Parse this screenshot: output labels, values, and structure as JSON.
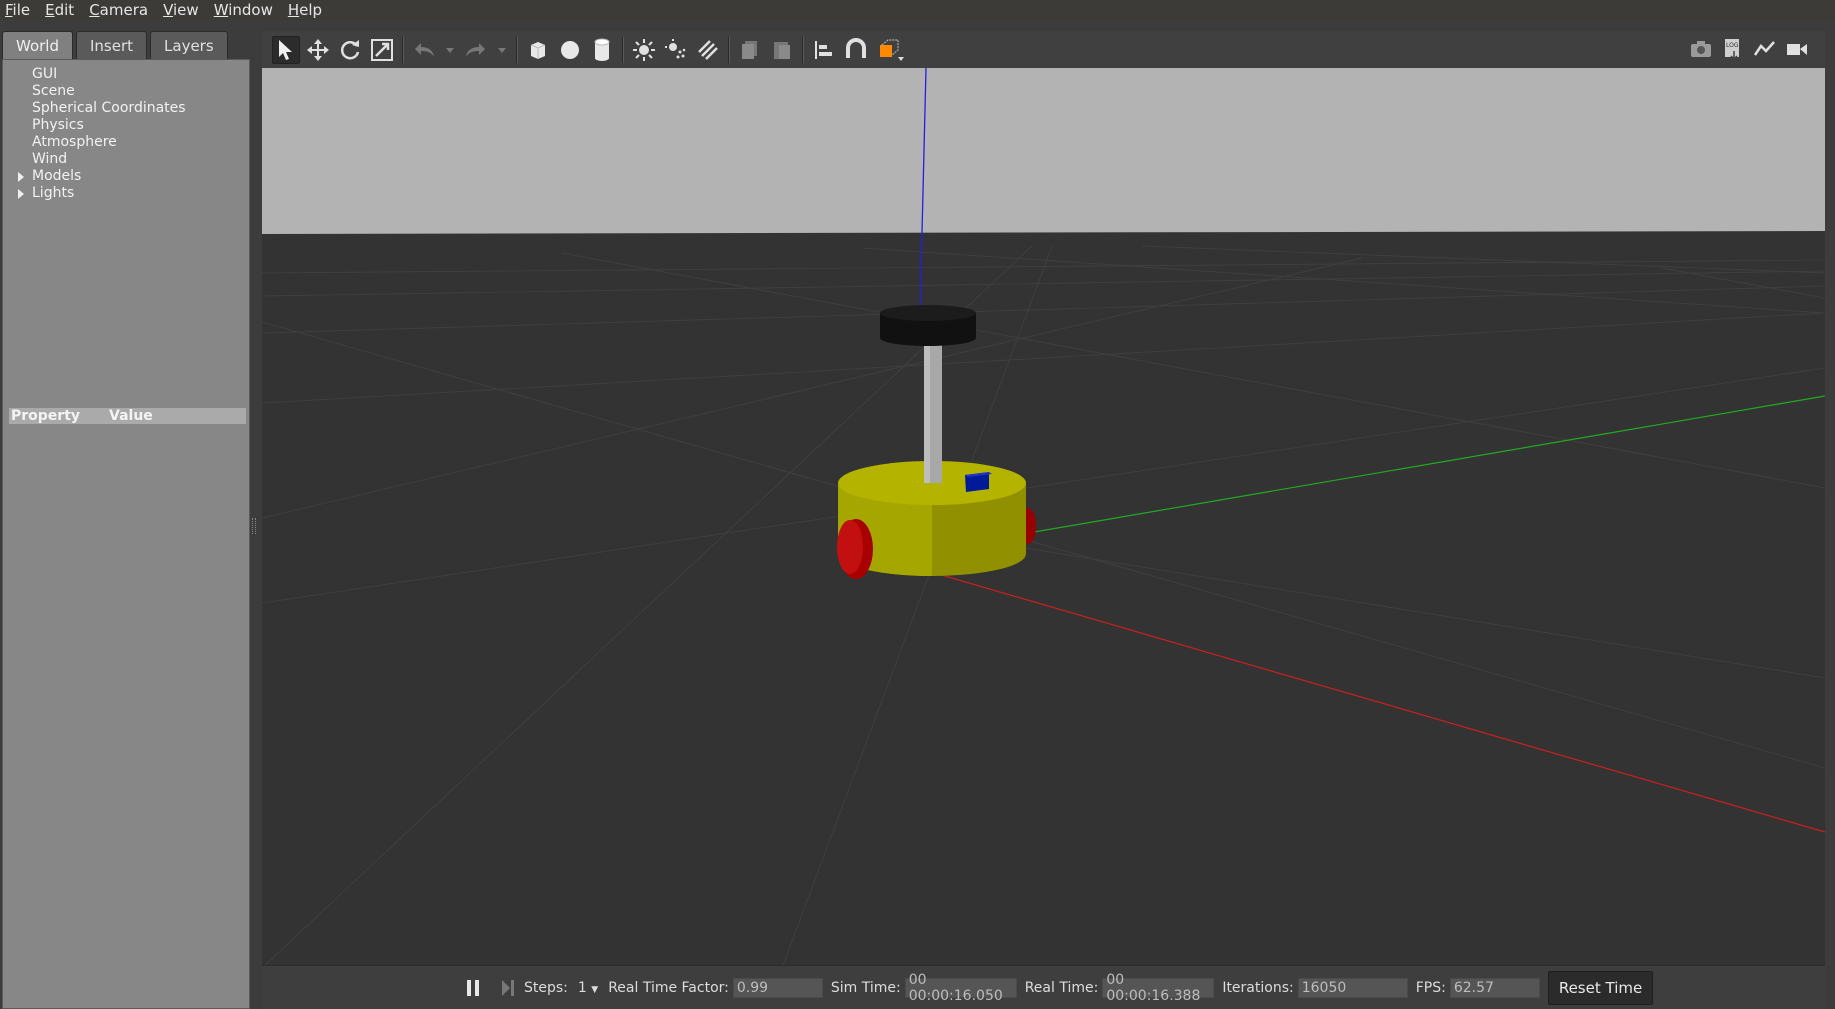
{
  "menu": {
    "items": [
      {
        "first": "F",
        "rest": "ile"
      },
      {
        "first": "E",
        "rest": "dit"
      },
      {
        "first": "C",
        "rest": "amera"
      },
      {
        "first": "V",
        "rest": "iew"
      },
      {
        "first": "W",
        "rest": "indow"
      },
      {
        "first": "H",
        "rest": "elp"
      }
    ]
  },
  "left_panel": {
    "tabs": [
      "World",
      "Insert",
      "Layers"
    ],
    "active_tab": "World",
    "tree": [
      "GUI",
      "Scene",
      "Spherical Coordinates",
      "Physics",
      "Atmosphere",
      "Wind",
      "Models",
      "Lights"
    ],
    "property_header": {
      "property": "Property",
      "value": "Value"
    }
  },
  "toolbar": {
    "tools": [
      "select-arrow-icon",
      "translate-icon",
      "rotate-icon",
      "scale-icon",
      "undo-icon",
      "undo-history-icon",
      "redo-icon",
      "redo-history-icon",
      "box-icon",
      "sphere-icon",
      "cylinder-icon",
      "point-light-icon",
      "spot-light-icon",
      "directional-light-icon",
      "copy-icon",
      "paste-icon",
      "align-icon",
      "snap-icon",
      "view-angle-icon"
    ],
    "right_tools": [
      "screenshot-icon",
      "log-icon",
      "plot-icon",
      "video-record-icon"
    ]
  },
  "statusbar": {
    "steps_label": "Steps:",
    "steps_value": "1",
    "rtf_label": "Real Time Factor:",
    "rtf_value": "0.99",
    "sim_time_label": "Sim Time:",
    "sim_time_value": "00 00:00:16.050",
    "real_time_label": "Real Time:",
    "real_time_value": "00 00:00:16.388",
    "iterations_label": "Iterations:",
    "iterations_value": "16050",
    "fps_label": "FPS:",
    "fps_value": "62.57",
    "reset_label": "Reset Time"
  },
  "colors": {
    "sky": "#b3b3b3",
    "ground": "#333333",
    "robot_body": "#a8a800",
    "wheel": "#b00000",
    "x_axis": "#cc1f1f",
    "y_axis": "#22aa22",
    "z_axis": "#2020dd"
  }
}
